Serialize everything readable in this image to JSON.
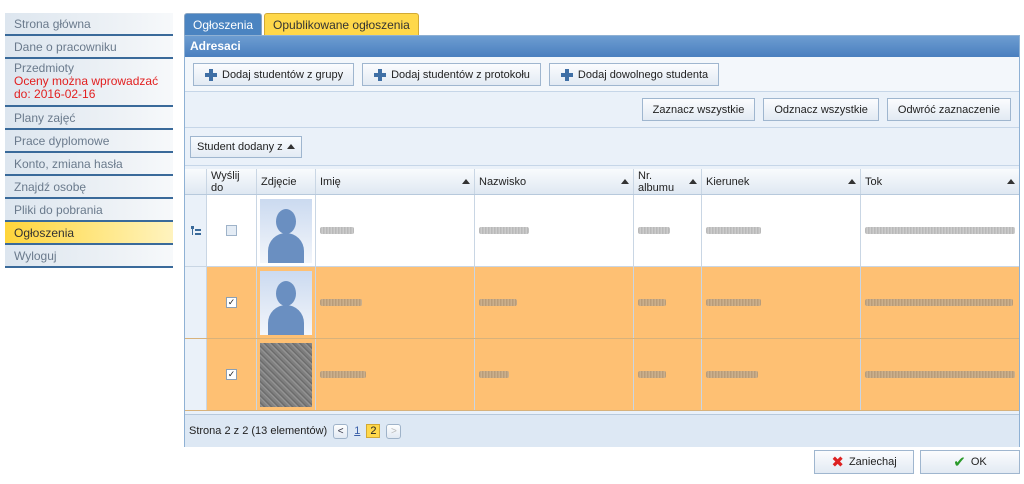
{
  "sidebar": {
    "items": [
      {
        "label": "Strona główna"
      },
      {
        "label": "Dane o pracowniku"
      },
      {
        "label": "Przedmioty",
        "note": "Oceny można wprowadzać do: 2016-02-16"
      },
      {
        "label": "Plany zajęć"
      },
      {
        "label": "Prace dyplomowe"
      },
      {
        "label": "Konto, zmiana hasła"
      },
      {
        "label": "Znajdź osobę"
      },
      {
        "label": "Pliki do pobrania"
      },
      {
        "label": "Ogłoszenia",
        "active": true
      },
      {
        "label": "Wyloguj"
      }
    ]
  },
  "tabs": [
    {
      "label": "Ogłoszenia"
    },
    {
      "label": "Opublikowane ogłoszenia"
    }
  ],
  "panel": {
    "title": "Adresaci",
    "add_from_group": "Dodaj studentów z grupy",
    "add_from_protocol": "Dodaj studentów z protokołu",
    "add_any": "Dodaj dowolnego studenta",
    "select_all": "Zaznacz wszystkie",
    "deselect_all": "Odznacz wszystkie",
    "invert_selection": "Odwróć zaznaczenie",
    "group_chip": "Student dodany z"
  },
  "grid": {
    "columns": [
      "Wyślij do",
      "Zdjęcie",
      "Imię",
      "Nazwisko",
      "Nr. albumu",
      "Kierunek",
      "Tok"
    ],
    "rows": [
      {
        "checked": false
      },
      {
        "checked": true
      },
      {
        "checked": true
      }
    ]
  },
  "pager": {
    "summary": "Strona 2 z 2 (13 elementów)",
    "page1": "1",
    "page2": "2",
    "prev": "<",
    "next": ">"
  },
  "actions": {
    "cancel": "Zaniechaj",
    "ok": "OK"
  },
  "colors": {
    "selected_row": "#fec073",
    "active_tab": "#ffd84a",
    "header_blue": "#4a7fbf"
  }
}
